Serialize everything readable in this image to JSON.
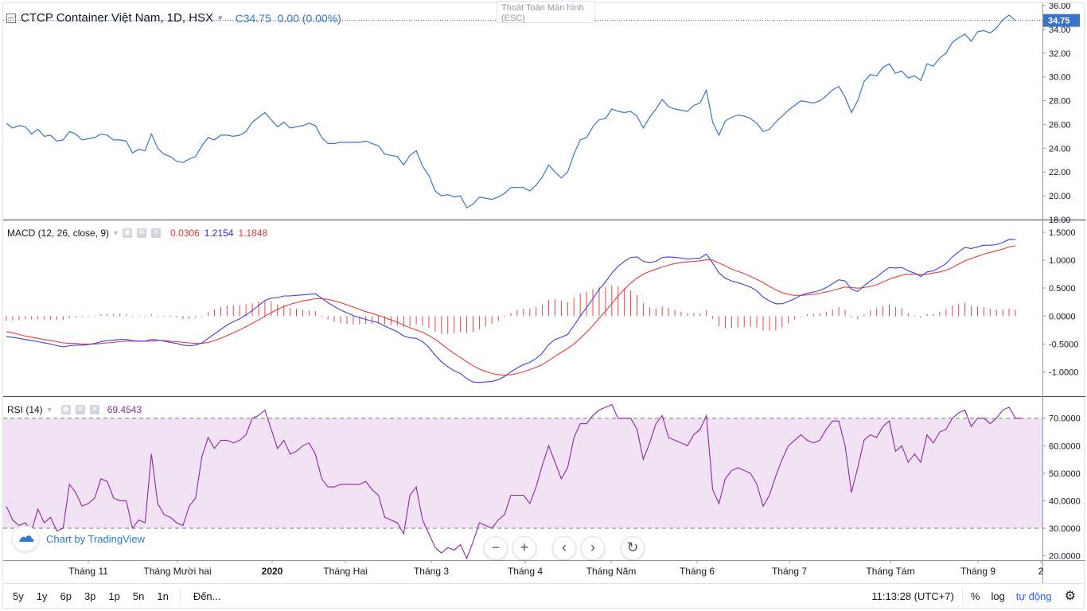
{
  "header": {
    "title": "CTCP Container Việt Nam, 1D, HSX",
    "price_prefix": "C",
    "price": "34.75",
    "change": "0.00 (0.00%)",
    "exit_fullscreen": "Thoát Toàn Màn hình",
    "exit_key": "(ESC)"
  },
  "macd_legend": {
    "label": "MACD (12, 26, close, 9)",
    "hist": "0.0306",
    "macd": "1.2154",
    "signal": "1.1848"
  },
  "rsi_legend": {
    "label": "RSI (14)",
    "value": "69.4543"
  },
  "branding": "Chart by TradingView",
  "price_badge": "34.75",
  "colors": {
    "price": "#3a75c4",
    "macd": "#3f3fe0",
    "signal": "#ef3a3a",
    "hist": "#e04848",
    "rsi": "#8a2b9e",
    "rsi_band": "#f1e3f4"
  },
  "icons": [
    "series-icon",
    "settings-icon",
    "close-icon",
    "zoom-out-icon",
    "zoom-in-icon",
    "scroll-left-icon",
    "scroll-right-icon",
    "reset-icon",
    "settings-gear-icon"
  ],
  "bottom": {
    "ranges": [
      "5y",
      "1y",
      "6p",
      "3p",
      "1p",
      "5n",
      "1n"
    ],
    "goto": "Đến...",
    "time": "11:13:28 (UTC+7)",
    "percent": "%",
    "log": "log",
    "auto": "tự động"
  },
  "chart_data": [
    {
      "type": "line",
      "name": "price",
      "x_labels": [
        "Tháng 11",
        "Tháng Mười hai",
        "2020",
        "Tháng Hai",
        "Tháng 3",
        "Tháng 4",
        "Tháng Năm",
        "Tháng 6",
        "Tháng 7",
        "Tháng Tám",
        "Tháng 9",
        "2"
      ],
      "y_ticks": [
        "36.00",
        "34.00",
        "32.00",
        "30.00",
        "28.00",
        "26.00",
        "24.00",
        "22.00",
        "20.00",
        "18.00"
      ],
      "ylim": [
        18,
        36
      ],
      "values": [
        26.1,
        25.7,
        25.9,
        25.8,
        25.2,
        25.6,
        25.0,
        25.1,
        24.6,
        24.7,
        25.4,
        25.2,
        24.7,
        24.8,
        24.9,
        25.2,
        25.1,
        24.7,
        24.7,
        24.6,
        23.6,
        23.9,
        23.8,
        25.2,
        24.0,
        23.5,
        23.3,
        22.9,
        22.8,
        23.1,
        23.3,
        24.2,
        24.9,
        24.7,
        25.1,
        25.1,
        25.0,
        25.1,
        25.4,
        26.2,
        26.6,
        27.0,
        26.4,
        25.8,
        26.2,
        25.7,
        25.8,
        25.9,
        26.1,
        25.9,
        24.9,
        24.4,
        24.4,
        24.5,
        24.5,
        24.5,
        24.5,
        24.6,
        24.4,
        24.2,
        23.5,
        23.4,
        23.3,
        22.6,
        23.4,
        23.8,
        22.5,
        21.7,
        20.4,
        20.0,
        20.1,
        19.9,
        20.0,
        19.0,
        19.3,
        19.9,
        19.8,
        19.7,
        19.9,
        20.2,
        20.7,
        20.7,
        20.7,
        20.4,
        20.9,
        21.6,
        22.6,
        22.0,
        21.5,
        22.0,
        23.5,
        24.7,
        24.9,
        25.8,
        26.4,
        26.5,
        27.3,
        27.1,
        27.0,
        27.1,
        26.7,
        25.7,
        26.6,
        27.3,
        28.1,
        27.5,
        27.3,
        27.2,
        27.1,
        27.6,
        27.8,
        28.9,
        26.2,
        25.1,
        26.3,
        26.6,
        26.8,
        26.7,
        26.5,
        26.1,
        25.4,
        25.6,
        26.2,
        26.7,
        27.2,
        27.6,
        28.0,
        27.9,
        27.8,
        28.0,
        28.4,
        28.9,
        29.2,
        28.3,
        27.0,
        28.0,
        29.6,
        30.2,
        30.1,
        30.8,
        31.1,
        30.3,
        30.5,
        29.9,
        30.1,
        29.7,
        31.1,
        30.9,
        31.6,
        32.0,
        32.9,
        33.3,
        33.6,
        33.0,
        33.8,
        33.9,
        33.7,
        34.1,
        34.8,
        35.2,
        34.75
      ]
    },
    {
      "type": "line",
      "name": "MACD",
      "y_ticks": [
        "1.5000",
        "1.0000",
        "0.5000",
        "0.0000",
        "-0.5000",
        "-1.0000"
      ],
      "ylim": [
        -1.35,
        1.6
      ],
      "series": [
        {
          "name": "MACD",
          "values": [
            -0.37,
            -0.38,
            -0.4,
            -0.42,
            -0.44,
            -0.46,
            -0.48,
            -0.5,
            -0.53,
            -0.55,
            -0.53,
            -0.52,
            -0.52,
            -0.51,
            -0.49,
            -0.46,
            -0.44,
            -0.43,
            -0.42,
            -0.42,
            -0.44,
            -0.45,
            -0.45,
            -0.42,
            -0.43,
            -0.45,
            -0.47,
            -0.49,
            -0.52,
            -0.53,
            -0.52,
            -0.48,
            -0.4,
            -0.32,
            -0.24,
            -0.16,
            -0.1,
            -0.05,
            0.02,
            0.1,
            0.19,
            0.28,
            0.32,
            0.33,
            0.36,
            0.36,
            0.37,
            0.38,
            0.39,
            0.4,
            0.32,
            0.24,
            0.17,
            0.11,
            0.06,
            0.01,
            -0.03,
            -0.06,
            -0.09,
            -0.12,
            -0.18,
            -0.23,
            -0.28,
            -0.36,
            -0.39,
            -0.4,
            -0.46,
            -0.56,
            -0.7,
            -0.82,
            -0.91,
            -0.98,
            -1.03,
            -1.12,
            -1.18,
            -1.19,
            -1.18,
            -1.17,
            -1.14,
            -1.08,
            -1.0,
            -0.93,
            -0.87,
            -0.83,
            -0.76,
            -0.66,
            -0.51,
            -0.42,
            -0.38,
            -0.33,
            -0.17,
            0.0,
            0.15,
            0.31,
            0.48,
            0.61,
            0.77,
            0.89,
            0.98,
            1.05,
            1.06,
            0.98,
            0.96,
            0.98,
            1.05,
            1.06,
            1.05,
            1.04,
            1.02,
            1.03,
            1.04,
            1.11,
            0.95,
            0.77,
            0.68,
            0.63,
            0.6,
            0.56,
            0.52,
            0.45,
            0.34,
            0.27,
            0.22,
            0.22,
            0.26,
            0.31,
            0.37,
            0.41,
            0.43,
            0.46,
            0.51,
            0.58,
            0.65,
            0.63,
            0.48,
            0.44,
            0.54,
            0.63,
            0.7,
            0.79,
            0.87,
            0.86,
            0.87,
            0.81,
            0.77,
            0.71,
            0.79,
            0.81,
            0.87,
            0.94,
            1.06,
            1.15,
            1.23,
            1.21,
            1.24,
            1.27,
            1.27,
            1.28,
            1.32,
            1.37,
            1.37
          ]
        },
        {
          "name": "Signal",
          "values": [
            -0.28,
            -0.3,
            -0.33,
            -0.36,
            -0.38,
            -0.4,
            -0.42,
            -0.44,
            -0.46,
            -0.48,
            -0.49,
            -0.49,
            -0.5,
            -0.5,
            -0.5,
            -0.49,
            -0.48,
            -0.47,
            -0.46,
            -0.45,
            -0.45,
            -0.45,
            -0.45,
            -0.45,
            -0.44,
            -0.44,
            -0.45,
            -0.46,
            -0.47,
            -0.48,
            -0.49,
            -0.49,
            -0.47,
            -0.44,
            -0.4,
            -0.35,
            -0.3,
            -0.25,
            -0.19,
            -0.13,
            -0.07,
            0.0,
            0.06,
            0.12,
            0.17,
            0.21,
            0.24,
            0.27,
            0.29,
            0.31,
            0.31,
            0.3,
            0.27,
            0.24,
            0.2,
            0.16,
            0.12,
            0.08,
            0.05,
            0.01,
            -0.03,
            -0.07,
            -0.11,
            -0.16,
            -0.21,
            -0.25,
            -0.29,
            -0.35,
            -0.42,
            -0.5,
            -0.59,
            -0.67,
            -0.74,
            -0.82,
            -0.89,
            -0.95,
            -0.99,
            -1.03,
            -1.05,
            -1.06,
            -1.05,
            -1.03,
            -1.0,
            -0.96,
            -0.92,
            -0.87,
            -0.8,
            -0.72,
            -0.65,
            -0.58,
            -0.5,
            -0.4,
            -0.29,
            -0.17,
            -0.04,
            0.09,
            0.22,
            0.36,
            0.48,
            0.59,
            0.68,
            0.75,
            0.8,
            0.84,
            0.88,
            0.91,
            0.94,
            0.96,
            0.97,
            0.98,
            0.99,
            1.01,
            1.0,
            0.95,
            0.9,
            0.84,
            0.8,
            0.76,
            0.71,
            0.66,
            0.6,
            0.53,
            0.47,
            0.42,
            0.39,
            0.37,
            0.37,
            0.38,
            0.39,
            0.41,
            0.43,
            0.46,
            0.49,
            0.52,
            0.51,
            0.5,
            0.51,
            0.53,
            0.56,
            0.61,
            0.66,
            0.7,
            0.73,
            0.75,
            0.75,
            0.74,
            0.75,
            0.77,
            0.79,
            0.82,
            0.87,
            0.93,
            0.99,
            1.03,
            1.07,
            1.11,
            1.14,
            1.17,
            1.2,
            1.24,
            1.26
          ]
        }
      ]
    },
    {
      "type": "line",
      "name": "RSI",
      "y_ticks": [
        "70.0000",
        "60.0000",
        "50.0000",
        "40.0000",
        "30.0000",
        "20.0000"
      ],
      "ylim": [
        19,
        76
      ],
      "series": [
        {
          "name": "RSI",
          "values": [
            38,
            33,
            31,
            32,
            29,
            37,
            32,
            34,
            29,
            30,
            46,
            43,
            38,
            39,
            41,
            48,
            47,
            41,
            40,
            40,
            30,
            33,
            32,
            57,
            39,
            35,
            34,
            32,
            31,
            38,
            41,
            56,
            63,
            59,
            62,
            62,
            61,
            62,
            64,
            70,
            71,
            73,
            66,
            59,
            62,
            57,
            58,
            60,
            61,
            57,
            48,
            45,
            45,
            46,
            46,
            46,
            46,
            47,
            44,
            42,
            34,
            33,
            32,
            28,
            42,
            45,
            33,
            28,
            23,
            21,
            23,
            22,
            24,
            19,
            25,
            32,
            31,
            30,
            33,
            35,
            42,
            42,
            42,
            39,
            45,
            53,
            60,
            54,
            48,
            52,
            63,
            68,
            68,
            71,
            73,
            74,
            75,
            70,
            70,
            70,
            66,
            55,
            61,
            68,
            71,
            63,
            62,
            61,
            60,
            64,
            66,
            71,
            44,
            39,
            48,
            51,
            52,
            51,
            50,
            46,
            38,
            42,
            49,
            55,
            60,
            62,
            64,
            62,
            61,
            62,
            66,
            69,
            69,
            60,
            43,
            52,
            62,
            64,
            63,
            67,
            69,
            58,
            60,
            54,
            57,
            54,
            64,
            61,
            65,
            66,
            70,
            72,
            73,
            67,
            70,
            70,
            68,
            70,
            73,
            74,
            70,
            70
          ]
        }
      ],
      "bands": [
        30,
        70
      ]
    }
  ]
}
